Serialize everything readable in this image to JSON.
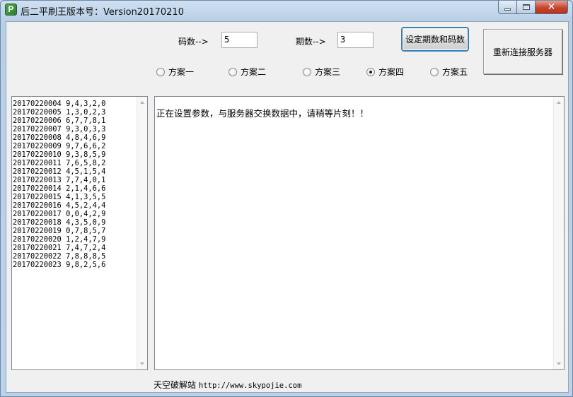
{
  "window": {
    "title": "后二平刷王版本号：Version20170210",
    "app_icon_glyph": "P",
    "close_glyph": "✕"
  },
  "settings": {
    "code_label": "码数-->",
    "code_value": "5",
    "period_label": "期数-->",
    "period_value": "3",
    "set_button": "设定期数和码数",
    "reconnect_button": "重新连接服务器"
  },
  "schemes": [
    {
      "label": "方案一",
      "selected": false
    },
    {
      "label": "方案二",
      "selected": false
    },
    {
      "label": "方案三",
      "selected": false
    },
    {
      "label": "方案四",
      "selected": true
    },
    {
      "label": "方案五",
      "selected": false
    }
  ],
  "history": [
    "20170220004 9,4,3,2,0",
    "20170220005 1,3,0,2,3",
    "20170220006 6,7,7,8,1",
    "20170220007 9,3,0,3,3",
    "20170220008 4,8,4,6,9",
    "20170220009 9,7,6,6,2",
    "20170220010 9,3,8,5,9",
    "20170220011 7,6,5,8,2",
    "20170220012 4,5,1,5,4",
    "20170220013 7,7,4,0,1",
    "20170220014 2,1,4,6,6",
    "20170220015 4,1,3,5,5",
    "20170220016 4,5,2,4,4",
    "20170220017 0,0,4,2,9",
    "20170220018 4,3,5,0,9",
    "20170220019 0,7,8,5,7",
    "20170220020 1,2,4,7,9",
    "20170220021 7,4,7,2,4",
    "20170220022 7,8,8,8,5",
    "20170220023 9,8,2,5,6"
  ],
  "status_text": "正在设置参数，与服务器交换数据中，请稍等片刻！！",
  "footer": {
    "site_name": "天空破解站",
    "url": "http://www.skypojie.com"
  }
}
